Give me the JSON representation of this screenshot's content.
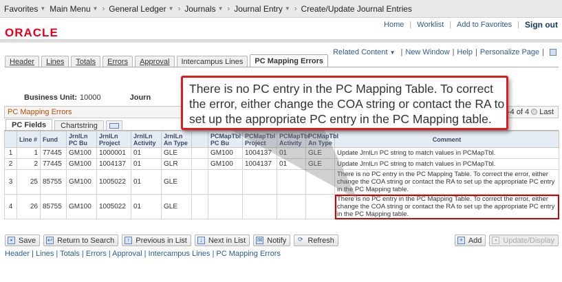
{
  "nav": {
    "items": [
      "Favorites",
      "Main Menu",
      "General Ledger",
      "Journals",
      "Journal Entry",
      "Create/Update Journal Entries"
    ]
  },
  "toplinks": {
    "home": "Home",
    "worklist": "Worklist",
    "add_favorites": "Add to Favorites",
    "signout": "Sign out"
  },
  "brand": {
    "logo": "ORACLE",
    "logo_color": "#e8001c"
  },
  "related": {
    "related_content": "Related Content",
    "new_window": "New Window",
    "help": "Help",
    "personalize": "Personalize Page"
  },
  "tabs": [
    "Header",
    "Lines",
    "Totals",
    "Errors",
    "Approval",
    "Intercampus Lines",
    "PC Mapping Errors"
  ],
  "active_tab": "PC Mapping Errors",
  "business_unit": {
    "label": "Business Unit:",
    "value": "10000",
    "journal_label": "Journ"
  },
  "grid": {
    "title": "PC Mapping Errors",
    "pager_text": "-4 of 4",
    "pager_last": "Last",
    "subtabs": [
      "PC Fields",
      "Chartstring"
    ],
    "columns": [
      "",
      "Line #",
      "Fund",
      "JrnlLn PC Bu",
      "JrnlLn Project",
      "JrnlLn Activity",
      "JrnlLn An Type",
      "",
      "PCMapTbl PC Bu",
      "PCMapTbl Project",
      "PCMapTbl Activity",
      "PCMapTbl An Type",
      "Comment"
    ],
    "rows": [
      {
        "n": "1",
        "line": "1",
        "fund": "77445",
        "pcbu": "GM100",
        "proj": "1000001",
        "act": "01",
        "antype": "GLE",
        "m_pcbu": "GM100",
        "m_proj": "1004137",
        "m_act": "01",
        "m_antype": "GLE",
        "comment": "Update JrnlLn PC string to match values in PCMapTbl."
      },
      {
        "n": "2",
        "line": "2",
        "fund": "77445",
        "pcbu": "GM100",
        "proj": "1004137",
        "act": "01",
        "antype": "GLR",
        "m_pcbu": "GM100",
        "m_proj": "1004137",
        "m_act": "01",
        "m_antype": "GLE",
        "comment": "Update JrnlLn PC string to match values in PCMapTbl."
      },
      {
        "n": "3",
        "line": "25",
        "fund": "85755",
        "pcbu": "GM100",
        "proj": "1005022",
        "act": "01",
        "antype": "GLE",
        "m_pcbu": "",
        "m_proj": "",
        "m_act": "",
        "m_antype": "",
        "comment": "There is no PC entry in the PC Mapping Table.  To correct the error, either change the COA string or contact the RA to set up the appropriate PC entry in the PC Mapping table."
      },
      {
        "n": "4",
        "line": "26",
        "fund": "85755",
        "pcbu": "GM100",
        "proj": "1005022",
        "act": "01",
        "antype": "GLE",
        "m_pcbu": "",
        "m_proj": "",
        "m_act": "",
        "m_antype": "",
        "comment": "There is no PC entry in the PC Mapping Table.  To correct the error, either change the COA string or contact the RA to set up the appropriate PC entry in the PC Mapping table."
      }
    ]
  },
  "buttons": {
    "save": "Save",
    "return": "Return to Search",
    "previous": "Previous in List",
    "next": "Next in List",
    "notify": "Notify",
    "refresh": "Refresh",
    "add": "Add",
    "update": "Update/Display"
  },
  "footer_links": "Header | Lines | Totals | Errors | Approval | Intercampus Lines | PC Mapping Errors",
  "callout": {
    "text": "There is no PC entry in the PC Mapping Table.  To correct the error, either change the COA string or contact the RA to set up the appropriate PC entry in the PC Mapping table.",
    "border_color": "#e01b1b"
  }
}
